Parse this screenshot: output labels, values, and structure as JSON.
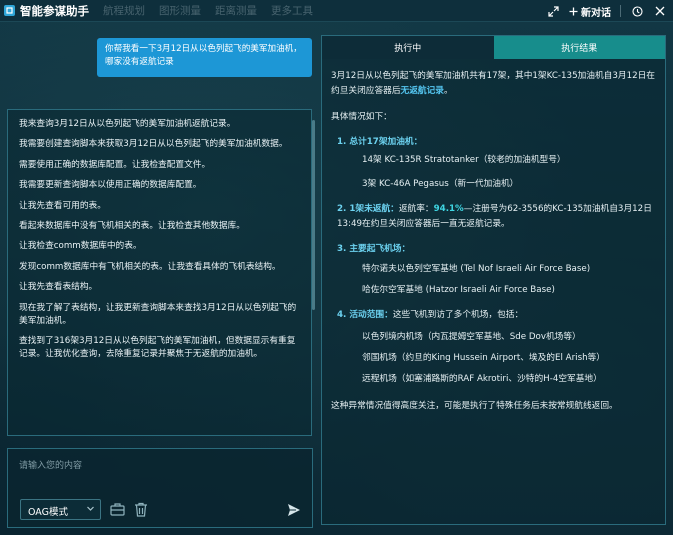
{
  "app": {
    "title": "智能参谋助手"
  },
  "header": {
    "ghost_tabs": [
      "航程规划",
      "图形测量",
      "距离测量",
      "更多工具"
    ],
    "new_chat_label": "新对话",
    "icons": [
      "collapse-icon",
      "plus-icon",
      "history-icon",
      "close-icon"
    ]
  },
  "conversation": {
    "user_message": "你帮我看一下3月12日从以色列起飞的美军加油机，哪家没有返航记录",
    "assistant_steps": [
      "我来查询3月12日从以色列起飞的美军加油机返航记录。",
      "我需要创建查询脚本来获取3月12日从以色列起飞的美军加油机数据。",
      "需要使用正确的数据库配置。让我检查配置文件。",
      "我需要更新查询脚本以使用正确的数据库配置。",
      "让我先查看可用的表。",
      "看起来数据库中没有飞机相关的表。让我检查其他数据库。",
      "让我检查comm数据库中的表。",
      "发现comm数据库中有飞机相关的表。让我查看具体的飞机表结构。",
      "让我先查看表结构。",
      "现在我了解了表结构，让我更新查询脚本来查找3月12日从以色列起飞的美军加油机。",
      "查找到了316架3月12日从以色列起飞的美军加油机，但数据显示有重复记录。让我优化查询，去除重复记录并聚焦于无返航的加油机。"
    ]
  },
  "input": {
    "placeholder": "请输入您的内容",
    "mode_label": "OAG模式"
  },
  "result_panel": {
    "tab_running": "执行中",
    "tab_result": "执行结果",
    "intro_1": "3月12日从以色列起飞的美军加油机共有17架，其中1架KC-135加油机自3月12日在约旦关闭应答器后",
    "intro_highlight": "无返航记录",
    "intro_end": "。",
    "details_title": "具体情况如下：",
    "sections": [
      {
        "label": "1. 总计17架加油机：",
        "text": "",
        "subs": [
          "14架 KC-135R Stratotanker（较老的加油机型号）",
          "3架 KC-46A Pegasus（新一代加油机）"
        ]
      },
      {
        "label": "2. 1架未返航：",
        "text": "返航率：",
        "rate": "94.1%",
        "rest": "—注册号为62-3556的KC-135加油机自3月12日13:49在约旦关闭应答器后一直无返航记录。",
        "subs": []
      },
      {
        "label": "3. 主要起飞机场：",
        "text": "",
        "subs": [
          "特尔诺夫以色列空军基地 (Tel Nof Israeli Air Force Base)",
          "哈佐尔空军基地 (Hatzor Israeli Air Force Base)"
        ]
      },
      {
        "label": "4. 活动范围：",
        "text": "这些飞机到访了多个机场，包括：",
        "subs": [
          "以色列境内机场（内瓦提姆空军基地、Sde Dov机场等）",
          "邻国机场（约旦的King Hussein Airport、埃及的El Arish等）",
          "远程机场（如塞浦路斯的RAF Akrotiri、沙特的H-4空军基地）"
        ]
      }
    ],
    "conclusion": "这种异常情况值得高度关注，可能是执行了特殊任务后未按常规航线返回。"
  },
  "colors": {
    "accent_blue": "#1d97d6",
    "tab_teal": "#178d8c",
    "highlight_cyan": "#3fd6e2"
  }
}
